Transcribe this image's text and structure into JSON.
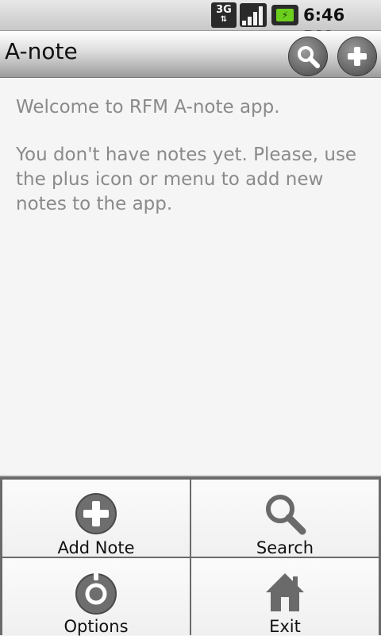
{
  "status_bar": {
    "network_label": "3G",
    "time": "6:46 PM",
    "signal_icon": "signal-icon",
    "battery_icon": "battery-charging-icon",
    "battery_color": "#6ccf1e"
  },
  "app_bar": {
    "title": "A-note",
    "search_icon": "search-icon",
    "add_icon": "plus-icon"
  },
  "content": {
    "welcome": "Welcome to RFM A-note app.",
    "hint": "You don't have notes yet. Please, use the plus icon or menu to add new notes to the app."
  },
  "menu": {
    "items": [
      {
        "label": "Add Note",
        "icon": "plus-circle-icon"
      },
      {
        "label": "Search",
        "icon": "search-icon"
      },
      {
        "label": "Options",
        "icon": "settings-dial-icon"
      },
      {
        "label": "Exit",
        "icon": "home-icon"
      }
    ]
  }
}
